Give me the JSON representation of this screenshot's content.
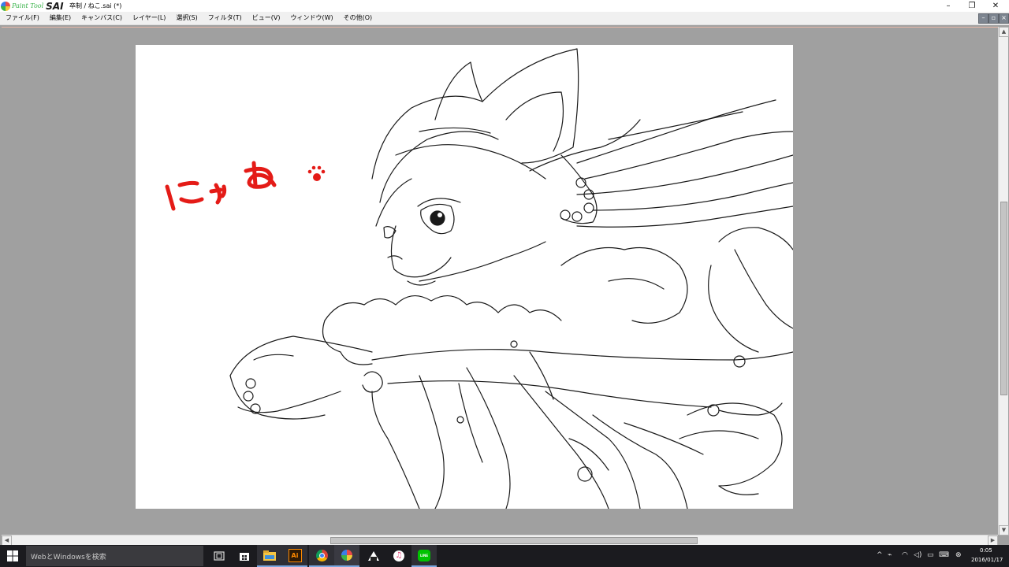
{
  "app": {
    "logo_painttool": "Paint Tool",
    "logo_sai": "SAI",
    "window_title": "卒制 / ねこ.sai (*)"
  },
  "window_controls": {
    "minimize": "–",
    "restore": "❐",
    "close": "✕"
  },
  "menu": [
    "ファイル(F)",
    "編集(E)",
    "キャンバス(C)",
    "レイヤー(L)",
    "選択(S)",
    "フィルタ(T)",
    "ビュー(V)",
    "ウィンドウ(W)",
    "その他(O)"
  ],
  "canvas": {
    "handwriting": "にゃあ",
    "handwriting_color": "#e41b17",
    "paw_icon": "paw-print-icon"
  },
  "taskbar": {
    "search_placeholder": "WebとWindowsを検索",
    "apps": [
      "task-view-icon",
      "store-icon",
      "file-explorer-icon",
      "illustrator-icon",
      "chrome-icon",
      "paint-tool-sai-icon",
      "onigiri-app-icon",
      "itunes-icon",
      "line-icon"
    ],
    "illustrator_label": "Ai",
    "line_label": "LINE",
    "tray_icons": [
      "chevron-up-icon",
      "network-icon",
      "wifi-icon",
      "volume-icon",
      "notification-icon",
      "keyboard-icon",
      "ime-icon"
    ],
    "clock_time": "0:05",
    "clock_date": "2016/01/17"
  }
}
